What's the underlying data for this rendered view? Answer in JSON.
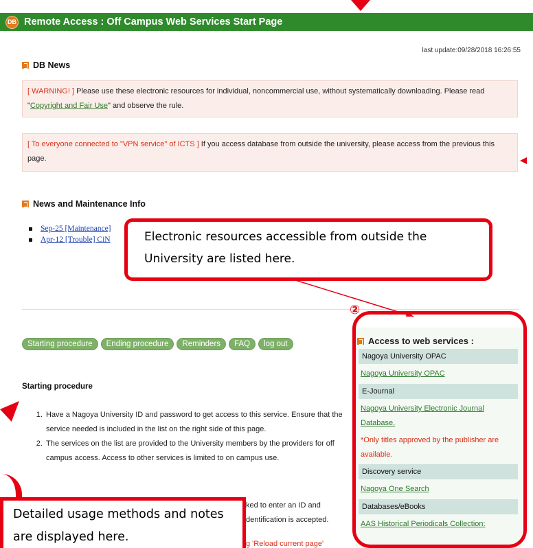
{
  "app": {
    "title": "Remote Access : Off Campus Web Services Start Page",
    "logo": "DB",
    "last_update": "last update:09/28/2018 16:26:55"
  },
  "db_news": {
    "heading": "DB News",
    "notices": [
      {
        "tag": "[ WARNING! ]",
        "text_before": " Please use these electronic resources for individual, noncommercial use, without systematically downloading. Please read \"",
        "link": "Copyright and Fair Use",
        "text_after": "\" and observe the rule."
      },
      {
        "tag": "[ To everyone connected to \"VPN service\" of ICTS ]",
        "text": " If you access database from outside the university, please access from the previous this page."
      }
    ]
  },
  "news_info": {
    "heading": "News and Maintenance Info",
    "items": [
      "Sep-25 [Maintenance]",
      "Apr-12 [Trouble] CiN"
    ]
  },
  "nav_pills": [
    "Starting procedure",
    "Ending procedure",
    "Reminders",
    "FAQ",
    "log out"
  ],
  "starting": {
    "heading": "Starting procedure",
    "steps": [
      "Have a Nagoya University ID and password to get access to this service. Ensure that the service needed is included in the list on the right side of this page.",
      "The services on the list are provided to the University members by the providers for off campus access. Access to other services is limited to on campus use."
    ],
    "fragments": [
      "ked to enter an ID and",
      "dentification is accepted.",
      "g 'Reload current page'"
    ]
  },
  "sidebar": {
    "heading": "Access to web services :",
    "sections": [
      {
        "category": "Nagoya University OPAC",
        "links": [
          "Nagoya University OPAC"
        ]
      },
      {
        "category": "E-Journal",
        "links": [
          "Nagoya University Electronic Journal Database."
        ],
        "note": "*Only titles approved by the publisher are available."
      },
      {
        "category": "Discovery service",
        "links": [
          "Nagoya One Search"
        ]
      },
      {
        "category": "Databases/eBooks",
        "links": [
          "AAS Historical Periodicals Collection:"
        ]
      }
    ]
  },
  "annotations": {
    "callout_resources": "Electronic resources accessible from outside the University are listed here.",
    "callout_usage": "Detailed usage methods and notes are displayed here.",
    "marker": "②"
  },
  "colors": {
    "titlebar": "#2f8a2c",
    "accent": "#e60012",
    "pill": "#7fb069",
    "notice_bg": "#fbeeea"
  }
}
